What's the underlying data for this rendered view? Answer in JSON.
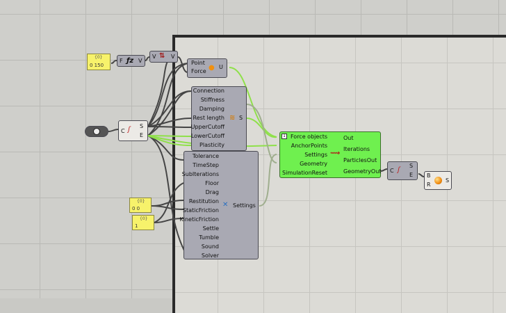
{
  "colors": {
    "canvas": "#cfcfcb",
    "group": "#dcdbd6",
    "component": "#a9a9b3",
    "solver": "#6ff04f",
    "panel": "#f7f26b",
    "wire": "#444444",
    "wire_highlight": "#8fe04a"
  },
  "panel_top": {
    "title": "{0}",
    "value": "0 150"
  },
  "panel_mid": {
    "title": "{0}",
    "value": "0 0"
  },
  "panel_low": {
    "title": "{0}",
    "value": "1"
  },
  "fz": {
    "in": "F",
    "out": "V",
    "icon": "fz-icon"
  },
  "vec": {
    "in": "V",
    "out": "V",
    "icon": "vector-arrows-icon"
  },
  "point_force": {
    "inputs": [
      "Point",
      "Force"
    ],
    "output": "U",
    "icon": "bulb-icon"
  },
  "curve_left": {
    "in": "C",
    "outs": [
      "S",
      "E"
    ],
    "icon": "curve-icon"
  },
  "goal": {
    "inputs": [
      "Connection",
      "Stiffness",
      "Damping",
      "Rest length",
      "UpperCutoff",
      "LowerCutoff",
      "Plasticity"
    ],
    "output": "S",
    "icon": "spring-icon"
  },
  "settings": {
    "inputs": [
      "Tolerance",
      "TimeStep",
      "SubIterations",
      "Floor",
      "Drag",
      "Restitution",
      "StaticFriction",
      "KineticFriction",
      "Settle",
      "Tumble",
      "Sound",
      "Solver"
    ],
    "output": "Settings",
    "icon": "tools-icon"
  },
  "solver": {
    "inputs": [
      "Force objects",
      "AnchorPoints",
      "Settings",
      "Geometry",
      "SimulationReset"
    ],
    "outputs": [
      "Out",
      "Iterations",
      "ParticlesOut",
      "GeometryOut"
    ],
    "icon": "kangaroo-icon"
  },
  "curve_right": {
    "in": "C",
    "outs": [
      "S",
      "E"
    ],
    "icon": "curve-icon"
  },
  "shader": {
    "inputs": [
      "B",
      "R"
    ],
    "output": "S",
    "icon": "orange-sphere-icon"
  }
}
